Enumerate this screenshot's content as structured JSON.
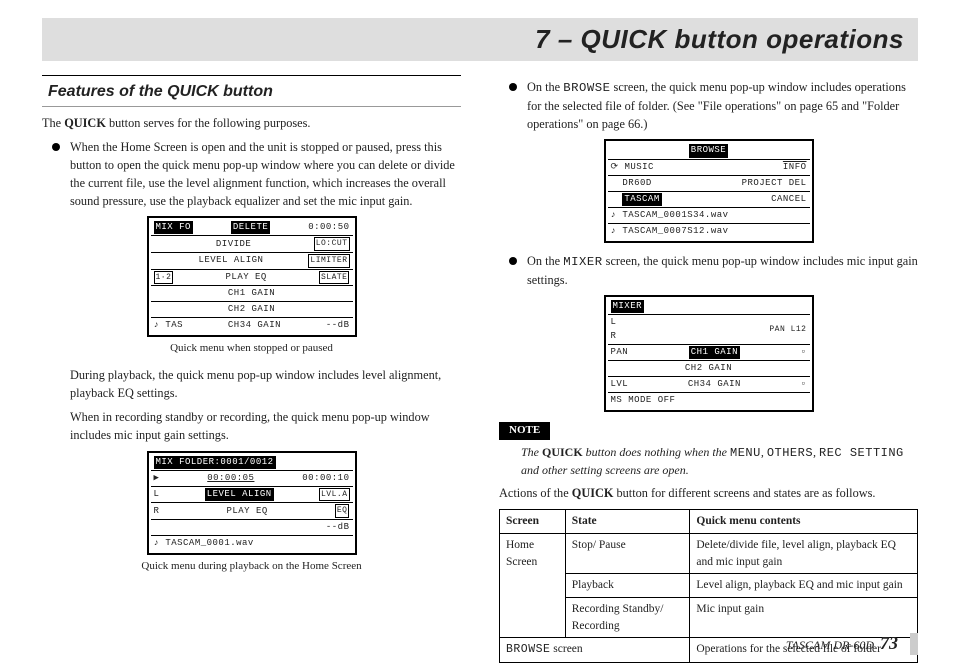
{
  "chapter": "7 – QUICK button operations",
  "section_heading": "Features of the QUICK button",
  "intro": {
    "pre": "The ",
    "bold": "QUICK",
    "post": " button serves for the following purposes."
  },
  "left_bullet": "When the Home Screen is open and the unit is stopped or paused, press this button to open the quick menu pop-up window where you can delete or divide the current file, use the level alignment function, which increases the overall sound pressure, use the playback equalizer and set the mic input gain.",
  "diag1": {
    "top_left": "MIX FO",
    "top_right": "0:00:50",
    "r1": "DELETE",
    "r2": "DIVIDE",
    "r2r": "LO:CUT",
    "r3": "LEVEL ALIGN",
    "r3r": "LIMITER",
    "r4": "PLAY EQ",
    "r4r": "SLATE",
    "r5": "CH1  GAIN",
    "r6": "CH2  GAIN",
    "r7": "CH34 GAIN",
    "side": "1·2",
    "bot": "TAS",
    "dbr": "--dB"
  },
  "caption1": "Quick menu when stopped or paused",
  "para_after1": "During playback, the quick menu pop-up window includes level alignment, playback EQ settings.",
  "para_after2": "When in recording standby or recording, the quick menu pop-up window includes mic input gain settings.",
  "diag2": {
    "top": "MIX  FOLDER:0001/0012",
    "time": "00:00:05",
    "rem": "00:00:10",
    "r1": "LEVEL ALIGN",
    "r1b": "LVL.A",
    "r2": "PLAY EQ",
    "r2b": "EQ",
    "db": "--dB",
    "bot": "TASCAM_0001.wav"
  },
  "caption2": "Quick menu during playback on the Home Screen",
  "right_bullet1_a": "On the ",
  "right_bullet1_b": "BROWSE",
  "right_bullet1_c": " screen, the quick menu pop-up window includes operations for the selected file of folder. (See \"File operations\" on page 65 and \"Folder operations\" on page 66.)",
  "diag3": {
    "title": "BROWSE",
    "r1": "MUSIC",
    "r1r": "INFO",
    "r2": "DR60D",
    "r2r": "PROJECT DEL",
    "r3": "TASCAM",
    "r3r": "CANCEL",
    "r4": "TASCAM_0001S34.wav",
    "r5": "TASCAM_0007S12.wav"
  },
  "right_bullet2_a": "On the ",
  "right_bullet2_b": "MIXER",
  "right_bullet2_c": " screen, the quick menu pop-up window includes mic input gain settings.",
  "diag4": {
    "title": "MIXER",
    "corner": "PAN L12",
    "r1": "CH1  GAIN",
    "r2": "CH2  GAIN",
    "r3": "CH34 GAIN",
    "l1": "PAN",
    "l2": "LVL",
    "bot": "MS MODE  OFF"
  },
  "note_label": "NOTE",
  "note_pre": "The ",
  "note_bold": "QUICK",
  "note_mid": " button does nothing when the ",
  "note_mono1": "MENU",
  "note_sep1": ", ",
  "note_mono2": "OTHERS",
  "note_sep2": ", ",
  "note_mono3": "REC SETTING",
  "note_tail": " and other setting screens are open.",
  "actions_intro_pre": "Actions of the ",
  "actions_intro_bold": "QUICK",
  "actions_intro_post": " button for different screens and states are as follows.",
  "table": {
    "h1": "Screen",
    "h2": "State",
    "h3": "Quick menu contents",
    "r1s": "Home Screen",
    "r1a": "Stop/ Pause",
    "r1b": "Delete/divide file, level align, playback EQ and mic input gain",
    "r2a": "Playback",
    "r2b": "Level align, playback EQ and mic input gain",
    "r3a": "Recording Standby/ Recording",
    "r3b": "Mic input gain",
    "r4s_mono": "BROWSE",
    "r4s_tail": " screen",
    "r4b": "Operations for the selected file of folder"
  },
  "footer_model": "TASCAM  DR-60D",
  "page_number": "73"
}
